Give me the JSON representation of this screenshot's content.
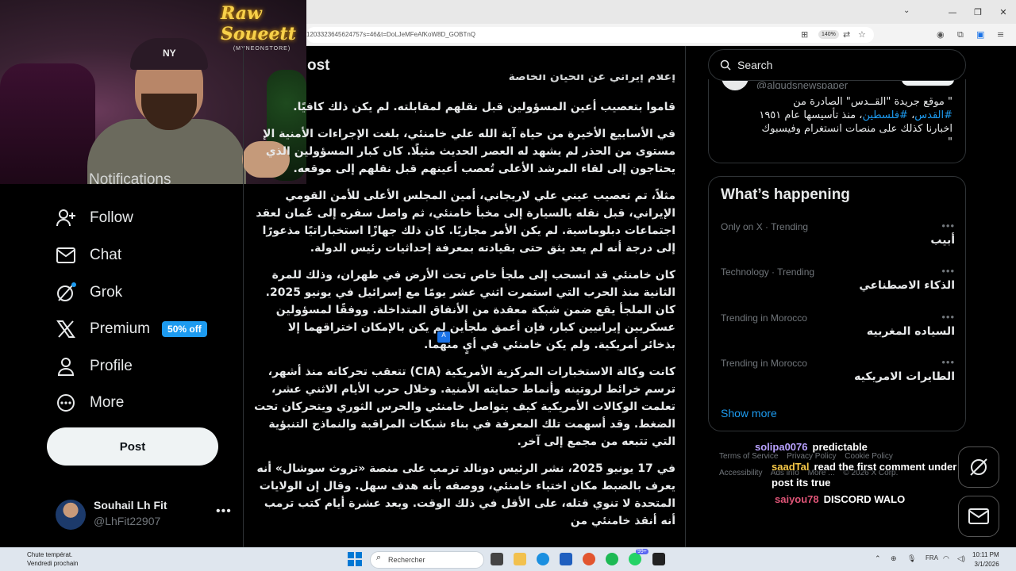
{
  "browser": {
    "url": "1203323645624757s=46&t=DoLJeMFeAfKoW8D_GOBTnQ",
    "zoom": "140%"
  },
  "webcam": {
    "logo_line1": "Raw Soueett",
    "logo_line2": "(MYNEONSTORE)",
    "cap_logo": "NY"
  },
  "nav": {
    "partial_label": "Notifications",
    "items": [
      {
        "label": "Follow",
        "icon": "follow-icon"
      },
      {
        "label": "Chat",
        "icon": "chat-icon"
      },
      {
        "label": "Grok",
        "icon": "grok-icon"
      },
      {
        "label": "Premium",
        "icon": "x-logo-icon",
        "badge": "50% off"
      },
      {
        "label": "Profile",
        "icon": "profile-icon"
      },
      {
        "label": "More",
        "icon": "more-icon"
      }
    ],
    "post_button": "Post",
    "account": {
      "name": "Souhail Lh Fit",
      "handle": "@LhFit22907",
      "more": "•••"
    }
  },
  "main": {
    "title": "ost",
    "paragraphs": [
      "إعلام إيراني عن الحيان الخاصة",
      "قاموا بتعصيب أعين المسؤولين قبل نقلهم لمقابلته. لم يكن ذلك كافيًا.",
      "في الأسابيع الأخيرة من حياة آية الله علي خامنئي، بلغت الإجراءات الأمنية الإ مستوى من الحذر لم يشهد له العصر الحديث مثيلًا. كان كبار المسؤولين الذي يحتاجون إلى لقاء المرشد الأعلى تُعصب أعينهم قبل نقلهم إلى موقعه.",
      "مثلاً، تم تعصيب عيني علي لاريجاني، أمين المجلس الأعلى للأمن القومي الإيراني، قبل نقله بالسيارة إلى مخبأ خامنئي، ثم واصل سفره إلى عُمان لعقد اجتماعات دبلوماسية. لم يكن الأمر مجازيًا. كان ذلك جهازًا استخباراتيًا مذعورًا إلى درجة أنه لم يعد يثق حتى بقيادته بمعرفة إحداثيات رئيس الدولة.",
      "كان خامنئي قد انسحب إلى ملجأ خاص تحت الأرض في طهران، وذلك للمرة الثانية منذ الحرب التي استمرت اثني عشر يومًا مع إسرائيل في يونيو 2025. كان الملجأ يقع ضمن شبكة معقدة من الأنفاق المتداخلة. ووفقًا لمسؤولين عسكريين إيرانيين كبار، فإن أعمق ملجأين لم يكن بالإمكان اختراقهما إلا بذخائر أمريكية. ولم يكن خامنئي في أيٍ منهما.",
      "كانت وكالة الاستخبارات المركزية الأمريكية (CIA) تتعقب تحركاته منذ أشهر، ترسم خرائط لروتينه وأنماط حمايته الأمنية. وخلال حرب الأيام الاثني عشر، تعلمت الوكالات الأمريكية كيف يتواصل خامنئي والحرس الثوري ويتحركان تحت الضغط. وقد أسهمت تلك المعرفة في بناء شبكات المراقبة والنماذج التنبؤية التي تتبعه من مجمع إلى آخر.",
      "في 17 يونيو 2025، نشر الرئيس دونالد ترمب على منصة «تروث سوشال» أنه يعرف بالضبط مكان اختباء خامنئي، ووصفه بأنه هدف سهل. وقال إن الولايات المتحدة لا تنوي قتله، على الأقل في ذلك الوقت. وبعد عشرة أيام كتب ترمب أنه أنقذ خامنئي من"
    ]
  },
  "sidebar": {
    "search_placeholder": "Search",
    "profile_card": {
      "handle": "@alqudsnewspaper",
      "bio_1": "\" موقع جريدة \"القــدس\" الصادرة من",
      "bio_tag1": "#القدس",
      "bio_tag2": "#فلسطين",
      "bio_2": "، منذ تأسيسها عام ١٩٥١",
      "bio_3": "اخبارنا كذلك على منصات انستغرام وفيسبوك",
      "bio_4": "\""
    },
    "trends_title": "What’s happening",
    "trends": [
      {
        "meta": "Only on X · Trending",
        "name": "أبيب"
      },
      {
        "meta": "Technology · Trending",
        "name": "الذكاء الاصطناعي"
      },
      {
        "meta": "Trending in Morocco",
        "name": "السياده المغربيه"
      },
      {
        "meta": "Trending in Morocco",
        "name": "الطايرات الامريكيه"
      }
    ],
    "show_more": "Show more",
    "footer": [
      "Terms of Service",
      "Privacy Policy",
      "Cookie Policy",
      "Accessibility",
      "Ads info",
      "More ...",
      "© 2026 X Corp."
    ]
  },
  "chat_overlay": [
    {
      "user": "solipa0076",
      "msg": "predictable",
      "color": "#b9a2ff"
    },
    {
      "user": "saadTal",
      "msg": "read the first comment under that post its true",
      "color": "#f7c948"
    },
    {
      "user": "saiyou78",
      "msg": "DISCORD WALO",
      "color": "#e05577"
    }
  ],
  "taskbar": {
    "weather_line1": "Chute températ.",
    "weather_line2": "Vendredi prochain",
    "search_placeholder": "Rechercher",
    "lang": "FRA",
    "time": "10:11 PM",
    "date": "3/1/2026",
    "notif_badge": "99+"
  }
}
